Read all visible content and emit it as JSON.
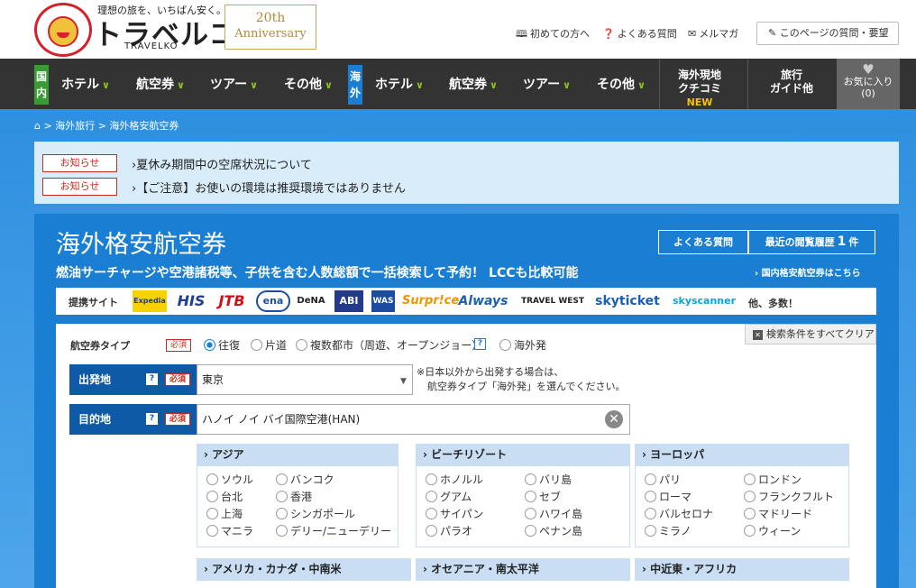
{
  "header": {
    "tagline": "理想の旅を、いちばん安く。",
    "brand": "トラベルコ",
    "brand_en": "TRAVELKO",
    "anniv_num": "20th",
    "anniv_text": "Anniversary",
    "links": [
      "初めての方へ",
      "よくある質問",
      "メルマガ"
    ],
    "feedback_btn": "このページの質問・要望"
  },
  "nav": {
    "domestic_tag": "国内",
    "overseas_tag": "海外",
    "domestic_items": [
      "ホテル",
      "航空券",
      "ツアー",
      "その他"
    ],
    "overseas_items": [
      "ホテル",
      "航空券",
      "ツアー",
      "その他"
    ],
    "reviews_l1": "海外現地",
    "reviews_l2": "クチコミ",
    "reviews_new": "NEW",
    "guide_l1": "旅行",
    "guide_l2": "ガイド他",
    "fav_label": "お気に入り",
    "fav_count": "(0)"
  },
  "breadcrumb": [
    "海外旅行",
    "海外格安航空券"
  ],
  "notices": [
    {
      "badge": "お知らせ",
      "text": "夏休み期間中の空席状況について"
    },
    {
      "badge": "お知らせ",
      "text": "【ご注意】お使いの環境は推奨環境ではありません"
    }
  ],
  "main": {
    "title": "海外格安航空券",
    "subtitle": "燃油サーチャージや空港諸税等、子供を含む人数総額で一括検索して予約！ LCCも比較可能",
    "faq_btn": "よくある質問",
    "history_label": "最近の閲覧履歴",
    "history_count": "1",
    "history_unit": "件",
    "domestic_link": "国内格安航空券はこちら"
  },
  "sites": {
    "label": "提携サイト",
    "logos": [
      "Expedia",
      "HIS",
      "JTB",
      "ena",
      "DeNA",
      "ABI",
      "WAS",
      "Surpr!ce",
      "Always",
      "TRAVEL WEST",
      "skyticket",
      "skyscanner"
    ],
    "more": "他、多数！"
  },
  "form": {
    "type_label": "航空券タイプ",
    "required": "必須",
    "types": [
      "往復",
      "片道",
      "複数都市（周遊、オープンジョー）",
      "海外発"
    ],
    "clear_btn": "検索条件をすべてクリア",
    "dep_label": "出発地",
    "dep_value": "東京",
    "dep_note_1": "※日本以外から出発する場合は、",
    "dep_note_2": "航空券タイプ「海外発」を選んでください。",
    "dest_label": "目的地",
    "dest_value": "ハノイ ノイ バイ国際空港(HAN)",
    "q_mark": "?"
  },
  "regions": [
    {
      "name": "アジア",
      "cities": [
        "ソウル",
        "バンコク",
        "台北",
        "香港",
        "上海",
        "シンガポール",
        "マニラ",
        "デリー/ニューデリー"
      ]
    },
    {
      "name": "ビーチリゾート",
      "cities": [
        "ホノルル",
        "バリ島",
        "グアム",
        "セブ",
        "サイパン",
        "ハワイ島",
        "パラオ",
        "ペナン島"
      ]
    },
    {
      "name": "ヨーロッパ",
      "cities": [
        "パリ",
        "ロンドン",
        "ローマ",
        "フランクフルト",
        "バルセロナ",
        "マドリード",
        "ミラノ",
        "ウィーン"
      ]
    },
    {
      "name": "アメリカ・カナダ・中南米",
      "cities": []
    },
    {
      "name": "オセアニア・南太平洋",
      "cities": []
    },
    {
      "name": "中近東・アフリカ",
      "cities": []
    }
  ],
  "colors": {
    "accent": "#1a7fd2",
    "nav_bg": "#333333",
    "domestic_tag": "#3a9a34",
    "overseas_tag": "#1a7fd2",
    "chevron": "#8dc21f",
    "required_red": "#c62a1e"
  }
}
